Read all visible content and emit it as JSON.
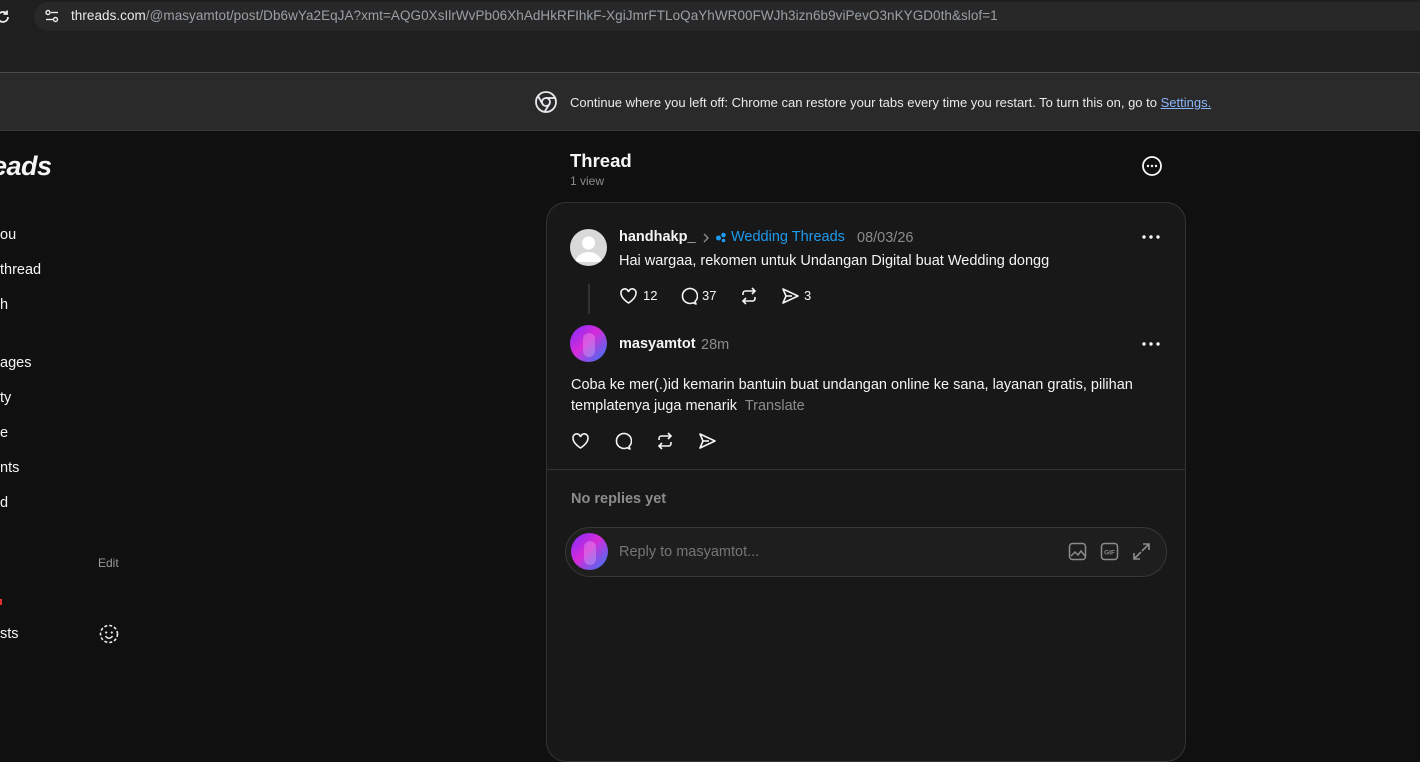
{
  "browser": {
    "url_domain": "threads.com",
    "url_path": "/@masyamtot/post/Db6wYa2EqJA?xmt=AQG0XsIlrWvPb06XhAdHkRFIhkF-XgiJmrFTLoQaYhWR00FWJh3izn6b9viPevO3nKYGD0th&slof=1"
  },
  "banner": {
    "text": "Continue where you left off: Chrome can restore your tabs every time you restart. To turn this on, go to",
    "link": "Settings."
  },
  "nav": {
    "logo": "eads",
    "items": [
      "ou",
      "thread",
      "h",
      "ages",
      "ty",
      "e",
      "nts",
      "d"
    ],
    "edit_label": "Edit",
    "last_item": "sts"
  },
  "thread": {
    "title": "Thread",
    "views": "1 view"
  },
  "parent_post": {
    "username": "handhakp_",
    "community": "Wedding Threads",
    "date": "08/03/26",
    "text": "Hai wargaa, rekomen untuk Undangan Digital buat Wedding dongg",
    "likes": "12",
    "replies": "37",
    "shares": "3"
  },
  "reply_post": {
    "username": "masyamtot",
    "time": "28m",
    "text": "Coba ke mer(.)id kemarin bantuin buat undangan online ke sana, layanan gratis, pilihan templatenya juga menarik",
    "translate": "Translate"
  },
  "replies_section": {
    "empty_text": "No replies yet",
    "reply_placeholder": "Reply to masyamtot..."
  },
  "colors": {
    "background": "#101010",
    "card": "#181818",
    "accent_link": "#1d9bf0",
    "chrome_link": "#8ab4f8"
  }
}
